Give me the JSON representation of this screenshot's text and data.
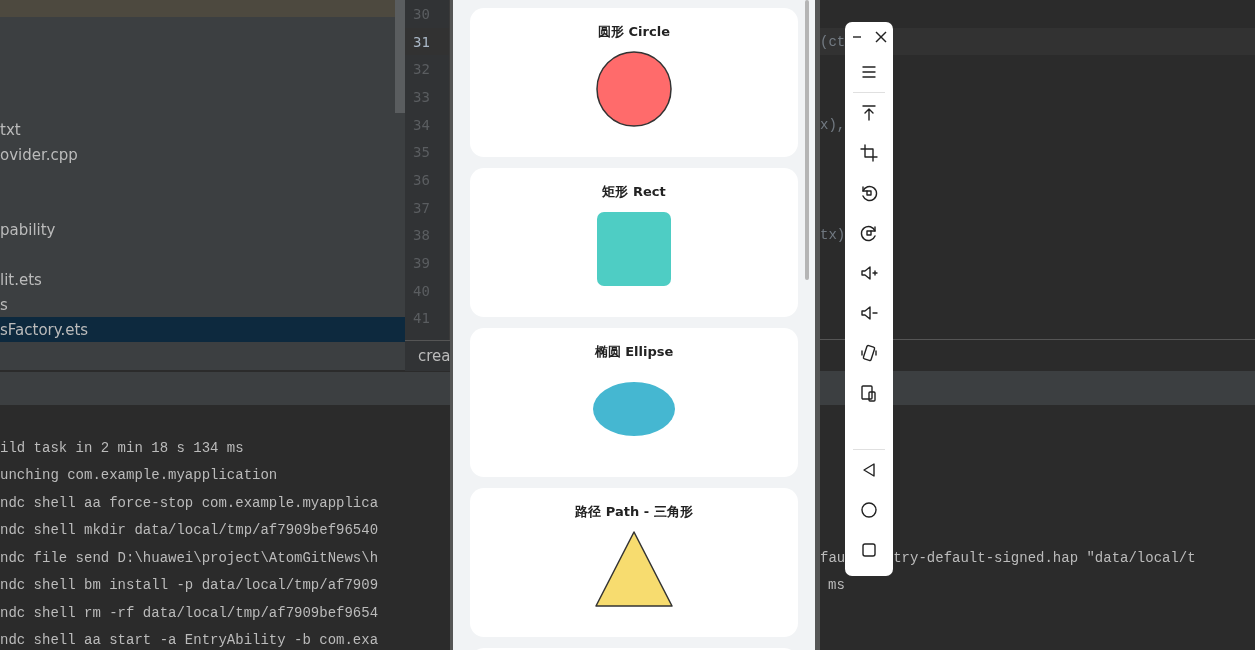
{
  "project_tree": {
    "items": [
      {
        "label": "txt",
        "selected": false
      },
      {
        "label": "ovider.cpp",
        "selected": false
      },
      {
        "label": "pability",
        "selected": false
      },
      {
        "label": "lit.ets",
        "selected": false
      },
      {
        "label": "s",
        "selected": false
      },
      {
        "label": "sFactory.ets",
        "selected": true
      }
    ]
  },
  "editor": {
    "lines": [
      {
        "number": "30",
        "current": false
      },
      {
        "number": "31",
        "current": true,
        "code": "(ct"
      },
      {
        "number": "32",
        "current": false
      },
      {
        "number": "33",
        "current": false
      },
      {
        "number": "34",
        "current": false,
        "code": "x),"
      },
      {
        "number": "35",
        "current": false
      },
      {
        "number": "36",
        "current": false
      },
      {
        "number": "37",
        "current": false
      },
      {
        "number": "38",
        "current": false,
        "code": "tx)"
      },
      {
        "number": "39",
        "current": false
      },
      {
        "number": "40",
        "current": false
      },
      {
        "number": "41",
        "current": false
      }
    ],
    "breadcrumb": "crea"
  },
  "console": {
    "lines": [
      {
        "left": "ild task in 2 min 18 s 134 ms"
      },
      {
        "left": "unching com.example.myapplication"
      },
      {
        "left": "ndc shell aa force-stop com.example.myapplica"
      },
      {
        "left": "ndc shell mkdir data/local/tmp/af7909bef96540"
      },
      {
        "left": "ndc file send D:\\huawei\\project\\AtomGitNews\\h",
        "right": [
          "fau",
          "try-default-signed.hap \"data/local/t"
        ]
      },
      {
        "left": "ndc shell bm install -p data/local/tmp/af7909",
        "right": [
          "ms"
        ]
      },
      {
        "left": "ndc shell rm -rf data/local/tmp/af7909bef9654"
      },
      {
        "left": "ndc shell aa start -a EntryAbility -b com.exa"
      }
    ]
  },
  "emulator": {
    "cards": [
      {
        "title": "圆形 Circle",
        "kind": "circle",
        "color": "#ff6b6b"
      },
      {
        "title": "矩形 Rect",
        "kind": "rect",
        "color": "#4ecdc4"
      },
      {
        "title": "椭圆 Ellipse",
        "kind": "ellipse",
        "color": "#45b7d1"
      },
      {
        "title": "路径 Path - 三角形",
        "kind": "triangle",
        "color": "#f7dc6f"
      }
    ]
  }
}
